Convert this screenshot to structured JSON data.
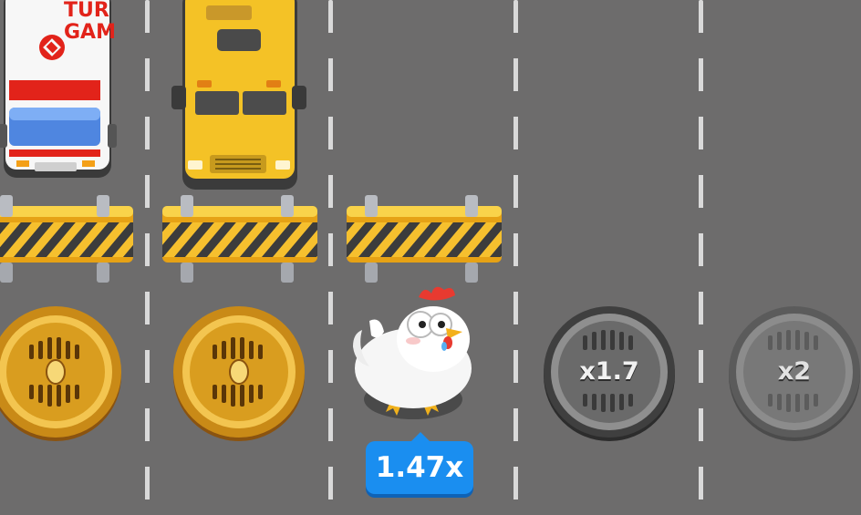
{
  "game": {
    "ambulance_sign": "TUR GAM",
    "current_multiplier": "1.47x",
    "next_multipliers": [
      {
        "label": "x1.7"
      },
      {
        "label": "x2"
      }
    ],
    "collected_coins": 2
  },
  "colors": {
    "road": "#6d6c6c",
    "lane_marking": "#d9d9d9",
    "barrier_yellow": "#f6c02e",
    "coin_gold": "#e4a21d",
    "badge_blue": "#1a8ef0",
    "bus_yellow": "#f4c226",
    "ambulance_red": "#e2231a"
  }
}
